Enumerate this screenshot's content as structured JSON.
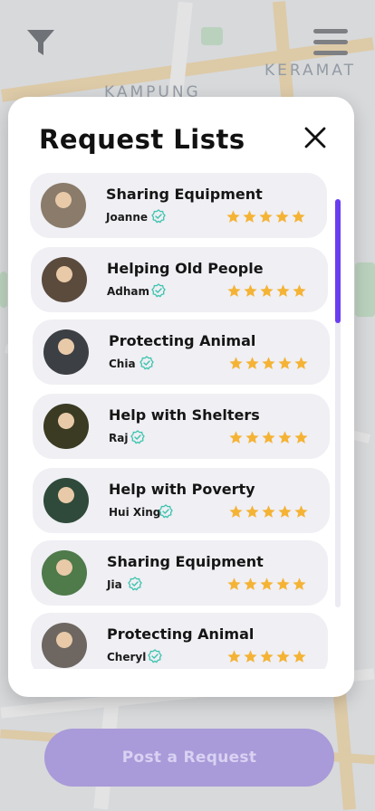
{
  "map": {
    "labels": [
      "KERAMAT",
      "KAMPUNG"
    ]
  },
  "modal": {
    "title": "Request Lists",
    "requests": [
      {
        "title": "Sharing Equipment",
        "name": "Joanne",
        "rating": 5,
        "avatar_color": "#8a7b6a"
      },
      {
        "title": "Helping Old People",
        "name": "Adham",
        "rating": 5,
        "avatar_color": "#5b4b3d"
      },
      {
        "title": "Protecting Animal",
        "name": "Chia",
        "rating": 5,
        "avatar_color": "#3c3f44"
      },
      {
        "title": "Help with Shelters",
        "name": "Raj",
        "rating": 5,
        "avatar_color": "#3b3a22"
      },
      {
        "title": "Help with Poverty",
        "name": "Hui Xing",
        "rating": 5,
        "avatar_color": "#2f4a3a"
      },
      {
        "title": "Sharing Equipment",
        "name": "Jia",
        "rating": 5,
        "avatar_color": "#4f7a4a"
      },
      {
        "title": "Protecting Animal",
        "name": "Cheryl",
        "rating": 5,
        "avatar_color": "#6e6761"
      }
    ]
  },
  "post_button": {
    "label": "Post a Request"
  },
  "colors": {
    "accent": "#6a3df0",
    "star": "#f5b335",
    "verify": "#3cc3ad",
    "button": "#a99ad9"
  }
}
